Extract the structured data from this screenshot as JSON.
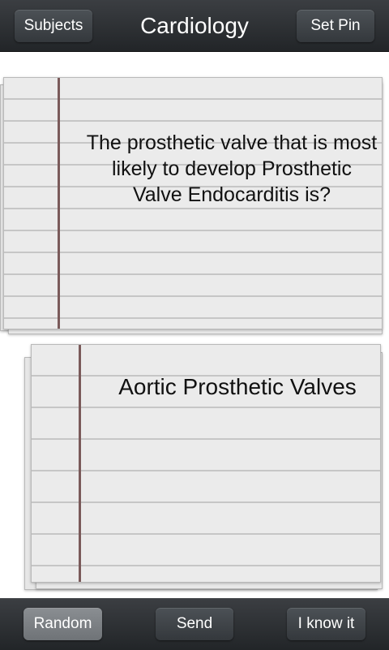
{
  "header": {
    "title": "Cardiology",
    "subjects_label": "Subjects",
    "set_pin_label": "Set Pin"
  },
  "card": {
    "question": "The prosthetic valve that is most likely to develop Prosthetic Valve Endocarditis is?",
    "answer": "Aortic Prosthetic Valves"
  },
  "footer": {
    "random_label": "Random",
    "send_label": "Send",
    "know_label": "I know it"
  }
}
